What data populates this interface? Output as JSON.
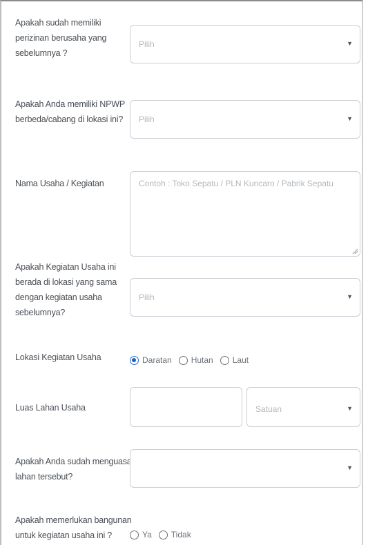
{
  "questions": {
    "q1": {
      "label": [
        "Apakah sudah memiliki",
        "perizinan berusaha yang",
        "sebelumnya ?"
      ],
      "placeholder": "Pilih"
    },
    "q2": {
      "label": [
        "Apakah Anda memiliki NPWP",
        "berbeda/cabang di lokasi ini?"
      ],
      "placeholder": "Pilih"
    },
    "q3": {
      "label": [
        "Nama Usaha / Kegiatan"
      ],
      "placeholder": "Contoh : Toko Sepatu / PLN Kuncaro / Pabrik Sepatu"
    },
    "q4": {
      "label": [
        "Apakah Kegiatan Usaha ini",
        "berada di lokasi yang sama",
        "dengan kegiatan usaha",
        "sebelumnya?"
      ],
      "placeholder": "Pilih"
    },
    "q5": {
      "label": [
        "Lokasi Kegiatan Usaha"
      ],
      "options": [
        "Daratan",
        "Hutan",
        "Laut"
      ],
      "selected": "Daratan"
    },
    "q6": {
      "label": [
        "Luas Lahan Usaha"
      ],
      "unit_placeholder": "Satuan"
    },
    "q7": {
      "label": [
        "Apakah Anda sudah menguasai",
        "lahan tersebut?"
      ],
      "placeholder": ""
    },
    "q8": {
      "label": [
        "Apakah memerlukan bangunan",
        "untuk kegiatan usaha ini ?"
      ],
      "options": [
        "Ya",
        "Tidak"
      ],
      "selected": ""
    }
  },
  "icons": {
    "dropdown": "chevron-down-icon",
    "resize": "resize-handle-icon"
  }
}
